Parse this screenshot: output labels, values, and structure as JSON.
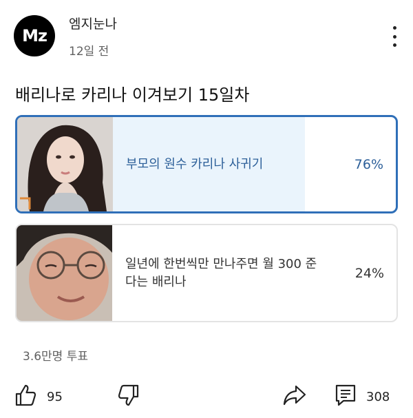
{
  "channel": {
    "avatar_text": "Mz",
    "name": "엠지눈나",
    "time": "12일 전"
  },
  "post": {
    "title": "배리나로 카리나 이겨보기 15일차"
  },
  "poll": {
    "options": [
      {
        "label": "부모의 원수 카리나 사귀기",
        "percent_label": "76%",
        "fraction": 0.76,
        "selected": true
      },
      {
        "label": "일년에 한번씩만 만나주면 월 300 준다는 배리나",
        "percent_label": "24%",
        "fraction": 0.24,
        "selected": false
      }
    ],
    "vote_count": "3.6만명 투표"
  },
  "actions": {
    "like_count": "95",
    "comment_count": "308"
  },
  "icons": [
    "more-vertical-icon",
    "thumbs-up-icon",
    "thumbs-down-icon",
    "share-icon",
    "comment-icon"
  ],
  "colors": {
    "selected_border": "#2f6fb8",
    "selected_fill": "#eaf4fc",
    "selected_text": "#2c5f99",
    "unselected_fill": "#ececec"
  }
}
